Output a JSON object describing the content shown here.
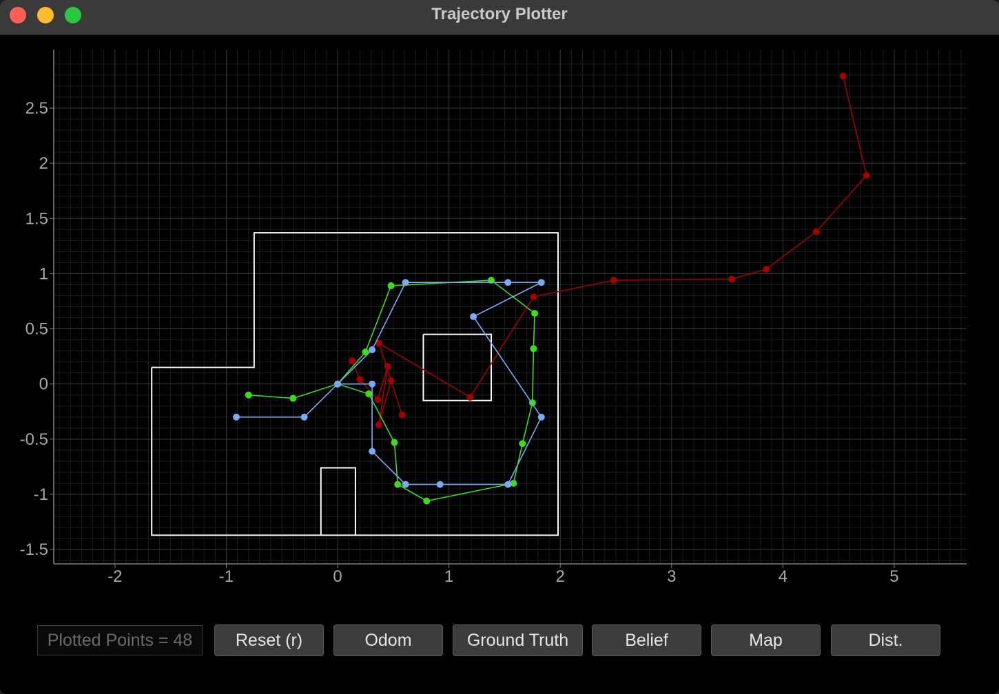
{
  "window": {
    "title": "Trajectory Plotter"
  },
  "chart_data": {
    "type": "line",
    "xlim": [
      -2.55,
      5.65
    ],
    "ylim": [
      -1.63,
      3.03
    ],
    "x_ticks": [
      -2,
      -1,
      0,
      1,
      2,
      3,
      4,
      5
    ],
    "x_tick_labels": [
      "-2",
      "-1",
      "0",
      "1",
      "2",
      "3",
      "4",
      "5"
    ],
    "y_ticks": [
      -1.5,
      -1,
      -0.5,
      0,
      0.5,
      1,
      1.5,
      2,
      2.5
    ],
    "y_tick_labels": [
      "-1.5",
      "-1",
      "-0.5",
      "0",
      "0.5",
      "1",
      "1.5",
      "2",
      "2.5"
    ],
    "grid": true,
    "colors": {
      "background": "#000000",
      "grid_major": "#3a3a3a",
      "grid_minor": "#1c1c1c",
      "axes": "#808080",
      "ticks": "#a8a8a8",
      "map": "#ffffff",
      "odom": "#a00000",
      "ground_truth": "#3bdc1b",
      "belief": "#7aaaf0"
    },
    "map": [
      [
        [
          -1.67,
          0.15
        ],
        [
          -0.75,
          0.15
        ],
        [
          -0.75,
          1.37
        ],
        [
          1.98,
          1.37
        ],
        [
          1.98,
          -1.37
        ],
        [
          -1.67,
          -1.37
        ],
        [
          -1.67,
          0.15
        ]
      ],
      [
        [
          0.77,
          0.45
        ],
        [
          1.38,
          0.45
        ],
        [
          1.38,
          -0.15
        ],
        [
          0.77,
          -0.15
        ],
        [
          0.77,
          0.45
        ]
      ],
      [
        [
          -0.15,
          -1.37
        ],
        [
          -0.15,
          -0.76
        ],
        [
          0.16,
          -0.76
        ],
        [
          0.16,
          -1.37
        ]
      ]
    ],
    "series": [
      {
        "key": "odom",
        "values": [
          [
            0.13,
            0.21
          ],
          [
            0.2,
            0.04
          ],
          [
            0.36,
            -0.14
          ],
          [
            0.45,
            0.16
          ],
          [
            0.37,
            -0.37
          ],
          [
            0.48,
            0.03
          ],
          [
            0.58,
            -0.28
          ],
          [
            0.37,
            0.37
          ],
          [
            1.19,
            -0.12
          ],
          [
            1.76,
            0.79
          ],
          [
            2.48,
            0.94
          ],
          [
            3.54,
            0.95
          ],
          [
            3.85,
            1.04
          ],
          [
            4.3,
            1.38
          ],
          [
            4.75,
            1.89
          ],
          [
            4.54,
            2.79
          ]
        ]
      },
      {
        "key": "ground_truth",
        "values": [
          [
            -0.8,
            -0.1
          ],
          [
            -0.4,
            -0.13
          ],
          [
            0.0,
            0.0
          ],
          [
            0.25,
            0.29
          ],
          [
            0.48,
            0.89
          ],
          [
            1.38,
            0.94
          ],
          [
            1.77,
            0.64
          ],
          [
            1.76,
            0.32
          ],
          [
            1.75,
            -0.17
          ],
          [
            1.66,
            -0.54
          ],
          [
            1.58,
            -0.9
          ],
          [
            0.8,
            -1.06
          ],
          [
            0.54,
            -0.91
          ],
          [
            0.51,
            -0.53
          ],
          [
            0.28,
            -0.09
          ],
          [
            0.0,
            0.0
          ]
        ]
      },
      {
        "key": "belief",
        "values": [
          [
            -0.91,
            -0.3
          ],
          [
            -0.3,
            -0.3
          ],
          [
            0.0,
            0.0
          ],
          [
            0.31,
            0.31
          ],
          [
            0.61,
            0.92
          ],
          [
            1.53,
            0.92
          ],
          [
            1.83,
            0.92
          ],
          [
            1.22,
            0.61
          ],
          [
            1.83,
            -0.3
          ],
          [
            1.53,
            -0.91
          ],
          [
            0.92,
            -0.91
          ],
          [
            0.61,
            -0.91
          ],
          [
            0.31,
            -0.61
          ],
          [
            0.31,
            0.0
          ],
          [
            0.0,
            0.0
          ]
        ]
      }
    ]
  },
  "controls": {
    "plotted_points": "Plotted Points = 48",
    "reset": "Reset (r)",
    "odom": "Odom",
    "ground_truth": "Ground Truth",
    "belief": "Belief",
    "map": "Map",
    "dist": "Dist."
  }
}
